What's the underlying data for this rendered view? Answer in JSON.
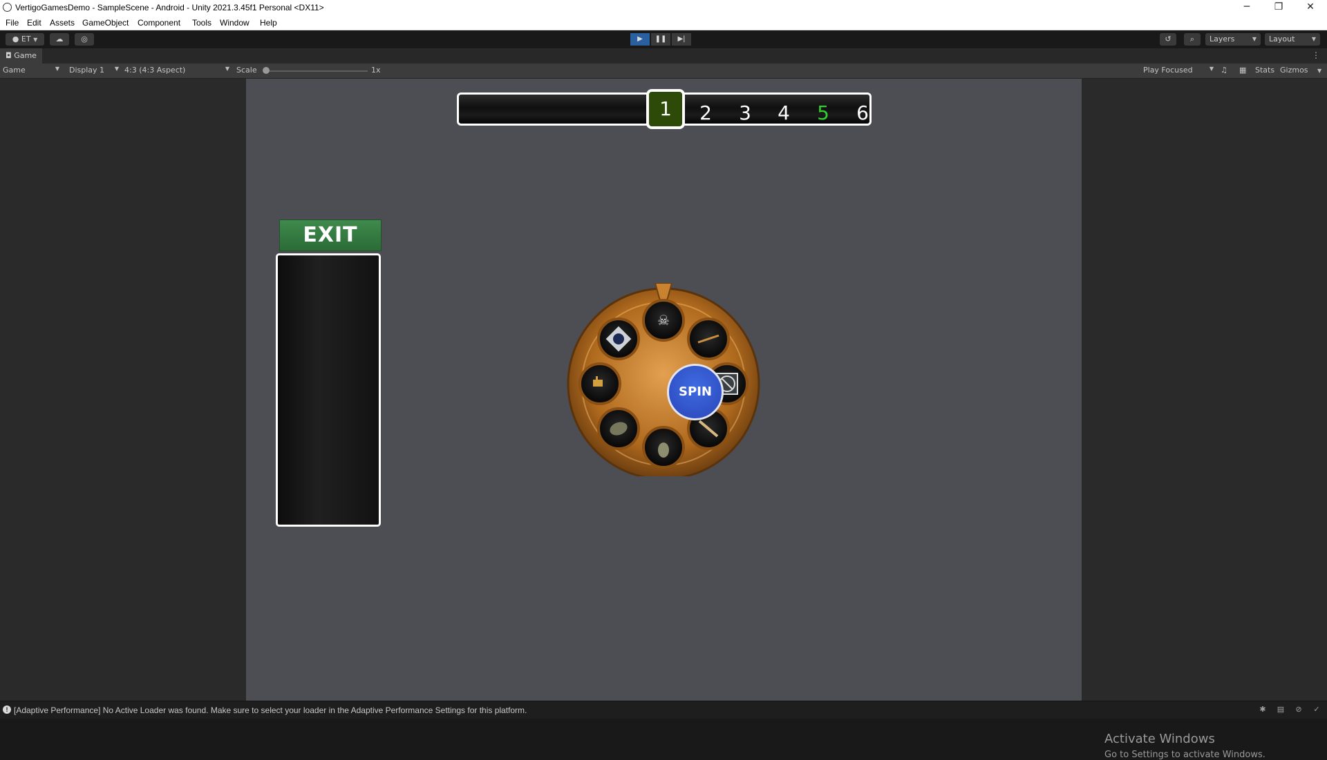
{
  "window": {
    "title": "VertigoGamesDemo - SampleScene - Android - Unity 2021.3.45f1 Personal <DX11>",
    "minimize": "─",
    "restore": "❐",
    "close": "✕"
  },
  "menu": [
    "File",
    "Edit",
    "Assets",
    "GameObject",
    "Component",
    "Tools",
    "Window",
    "Help"
  ],
  "toolbar": {
    "account_label": "ET",
    "layers_label": "Layers",
    "layout_label": "Layout"
  },
  "tab": {
    "label": "Game"
  },
  "game_toolbar": {
    "mode": "Game",
    "display": "Display 1",
    "aspect": "4:3 (4:3 Aspect)",
    "scale_label": "Scale",
    "scale_value": "1x",
    "play_focused": "Play Focused",
    "stats": "Stats",
    "gizmos": "Gizmos"
  },
  "game": {
    "zones": [
      "1",
      "2",
      "3",
      "4",
      "5",
      "6"
    ],
    "active_zone": "1",
    "highlight_zone": "5",
    "exit_label": "EXIT",
    "spin_label": "SPIN",
    "wheel_slots": [
      "skull",
      "rifle",
      "no-entry",
      "knife",
      "grenade-hand",
      "grenade",
      "ammo",
      "cooldown"
    ]
  },
  "watermark": {
    "line1": "Activate Windows",
    "line2": "Go to Settings to activate Windows."
  },
  "status": {
    "message": "[Adaptive Performance] No Active Loader was found. Make sure to select your loader in the Adaptive Performance Settings for this platform."
  },
  "colors": {
    "exit_green": "#3a7f46",
    "spin_blue": "#3157d2",
    "zone_active_bg": "#2e4a08",
    "zone_highlight": "#2fd12f",
    "wheel_bronze": "#b06a1e"
  }
}
